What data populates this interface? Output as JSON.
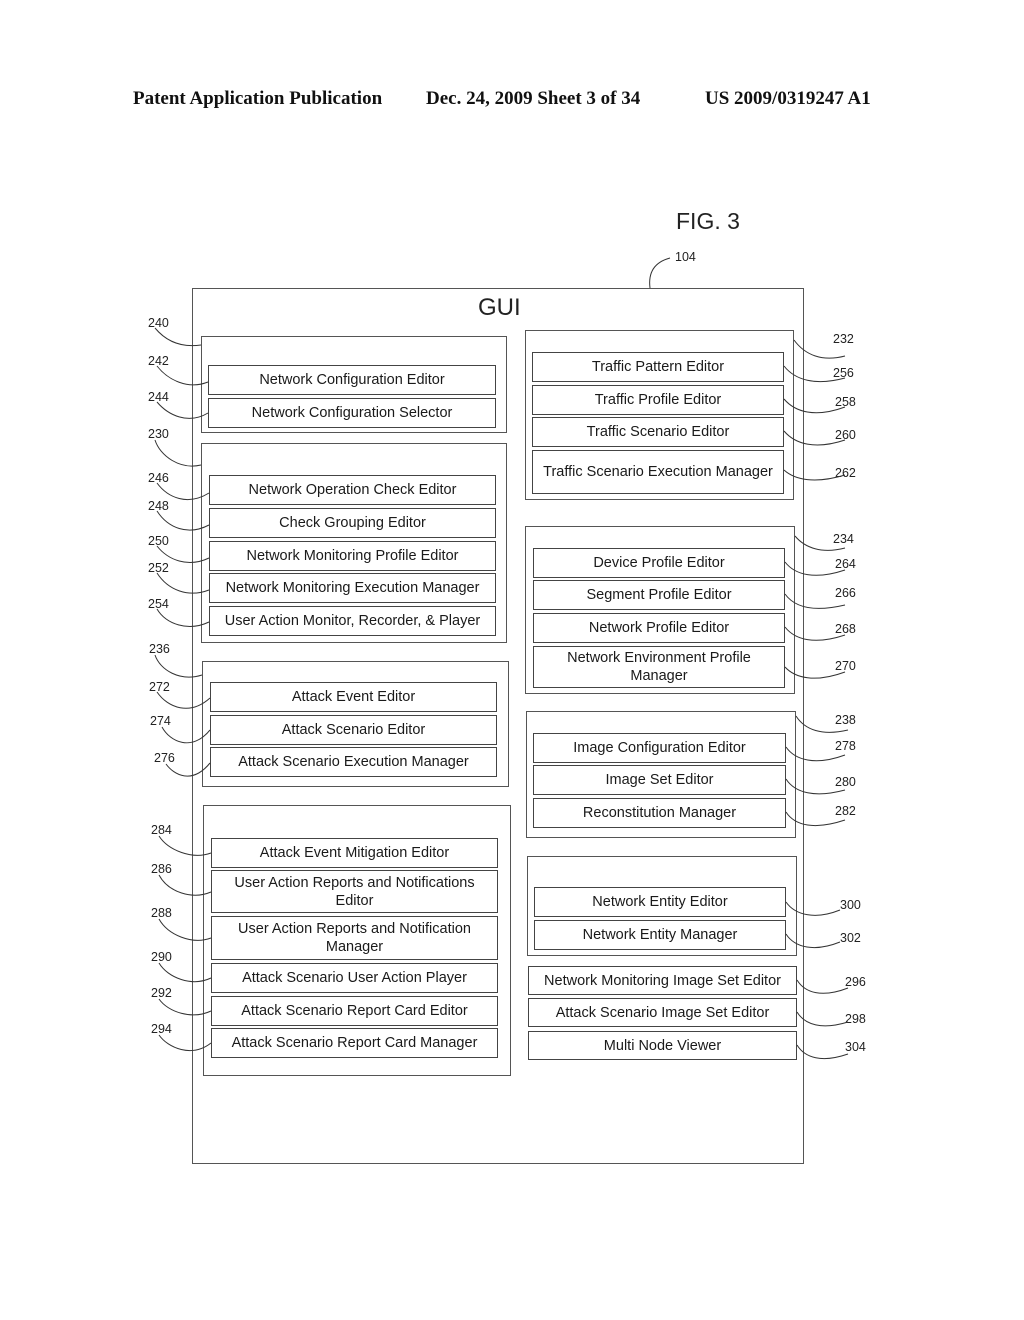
{
  "header": {
    "publication": "Patent Application Publication",
    "date_sheet": "Dec. 24, 2009   Sheet 3 of 34",
    "number": "US 2009/0319247 A1"
  },
  "figure": {
    "label": "FIG. 3",
    "ref_main": "104",
    "title": "GUI"
  },
  "left_groups": [
    {
      "ref": "240",
      "items": [
        {
          "ref": "242",
          "label": "Network Configuration Editor"
        },
        {
          "ref": "244",
          "label": "Network Configuration Selector"
        }
      ]
    },
    {
      "ref": "230",
      "items": [
        {
          "ref": "246",
          "label": "Network Operation Check Editor"
        },
        {
          "ref": "248",
          "label": "Check Grouping Editor"
        },
        {
          "ref": "250",
          "label": "Network Monitoring Profile Editor"
        },
        {
          "ref": "252",
          "label": "Network Monitoring Execution Manager"
        },
        {
          "ref": "254",
          "label": "User Action Monitor, Recorder, & Player"
        }
      ]
    },
    {
      "ref": "236",
      "items": [
        {
          "ref": "272",
          "label": "Attack Event Editor"
        },
        {
          "ref": "274",
          "label": "Attack Scenario Editor"
        },
        {
          "ref": "276",
          "label": "Attack Scenario Execution Manager"
        }
      ]
    },
    {
      "ref": "",
      "items": [
        {
          "ref": "284",
          "label": "Attack Event Mitigation Editor"
        },
        {
          "ref": "286",
          "label": "User Action Reports and Notifications Editor"
        },
        {
          "ref": "288",
          "label": "User Action Reports and Notification Manager"
        },
        {
          "ref": "290",
          "label": "Attack Scenario User Action Player"
        },
        {
          "ref": "292",
          "label": "Attack Scenario Report Card Editor"
        },
        {
          "ref": "294",
          "label": "Attack Scenario Report Card Manager"
        }
      ]
    }
  ],
  "right_groups": [
    {
      "ref": "232",
      "items": [
        {
          "ref": "256",
          "label": "Traffic Pattern Editor"
        },
        {
          "ref": "258",
          "label": "Traffic Profile Editor"
        },
        {
          "ref": "260",
          "label": "Traffic Scenario Editor"
        },
        {
          "ref": "262",
          "label": "Traffic Scenario Execution Manager"
        }
      ]
    },
    {
      "ref": "234",
      "items": [
        {
          "ref": "264",
          "label": "Device Profile Editor"
        },
        {
          "ref": "266",
          "label": "Segment Profile Editor"
        },
        {
          "ref": "268",
          "label": "Network Profile Editor"
        },
        {
          "ref": "270",
          "label": "Network Environment Profile Manager"
        }
      ]
    },
    {
      "ref": "238",
      "items": [
        {
          "ref": "278",
          "label": "Image Configuration Editor"
        },
        {
          "ref": "280",
          "label": "Image Set Editor"
        },
        {
          "ref": "282",
          "label": "Reconstitution Manager"
        }
      ]
    },
    {
      "ref": "",
      "items": [
        {
          "ref": "300",
          "label": "Network Entity Editor"
        },
        {
          "ref": "302",
          "label": "Network Entity Manager"
        }
      ]
    }
  ],
  "standalone_items": [
    {
      "ref": "296",
      "label": "Network Monitoring Image Set Editor"
    },
    {
      "ref": "298",
      "label": "Attack Scenario Image Set Editor"
    },
    {
      "ref": "304",
      "label": "Multi Node Viewer"
    }
  ]
}
